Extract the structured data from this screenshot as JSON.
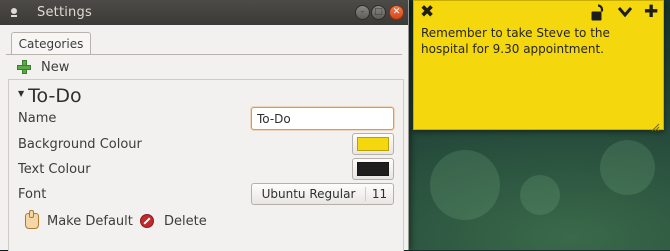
{
  "settings_window": {
    "title": "Settings",
    "tabs": [
      "Categories"
    ],
    "toolbar": {
      "new_label": "New"
    },
    "category": {
      "name": "To-Do",
      "fields": {
        "name_label": "Name",
        "name_value": "To-Do",
        "background_label": "Background Colour",
        "background_color": "#f4d70d",
        "text_label": "Text Colour",
        "text_color": "#1e1e1e",
        "font_label": "Font",
        "font_name": "Ubuntu Regular",
        "font_size": "11"
      },
      "actions": {
        "make_default": "Make Default",
        "delete": "Delete"
      }
    }
  },
  "sticky_note": {
    "text": "Remember to take Steve to the hospital for 9.30 appointment.",
    "background_color": "#f4d70d"
  },
  "colors": {
    "titlebar": "#3b3a36",
    "close_button": "#e0531f",
    "accent_green": "#5ca94a",
    "delete_red": "#c2282c"
  }
}
